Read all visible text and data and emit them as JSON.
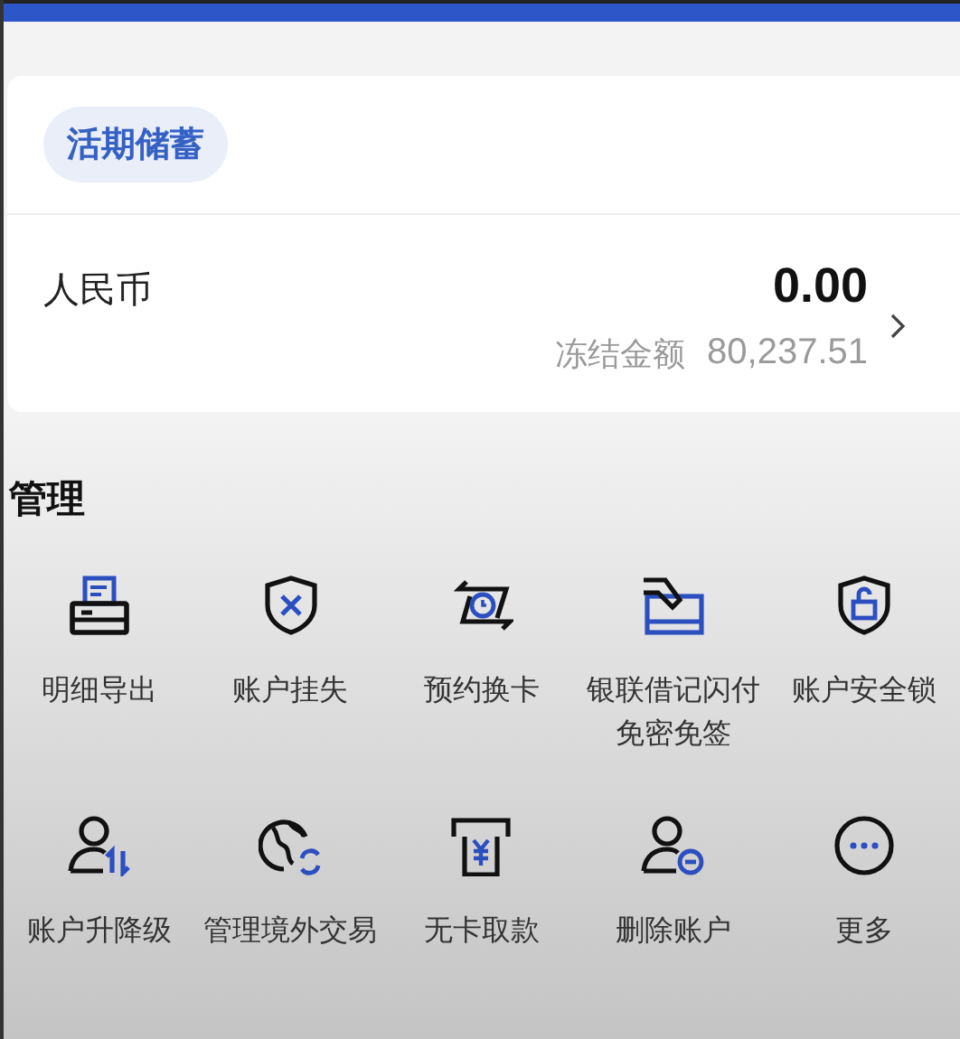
{
  "account_card": {
    "tag": "活期储蓄",
    "currency": "人民币",
    "balance": "0.00",
    "frozen_label": "冻结金额",
    "frozen_amount": "80,237.51"
  },
  "section": {
    "title": "管理",
    "items": [
      {
        "kind": "printer",
        "label": "明细导出"
      },
      {
        "kind": "shield-x",
        "label": "账户挂失"
      },
      {
        "kind": "swap",
        "label": "预约换卡"
      },
      {
        "kind": "card",
        "label": "银联借记闪付免密免签"
      },
      {
        "kind": "shield-lock",
        "label": "账户安全锁"
      },
      {
        "kind": "user-updown",
        "label": "账户升降级"
      },
      {
        "kind": "globe",
        "label": "管理境外交易"
      },
      {
        "kind": "atm",
        "label": "无卡取款"
      },
      {
        "kind": "user-minus",
        "label": "删除账户"
      },
      {
        "kind": "more",
        "label": "更多"
      }
    ]
  }
}
